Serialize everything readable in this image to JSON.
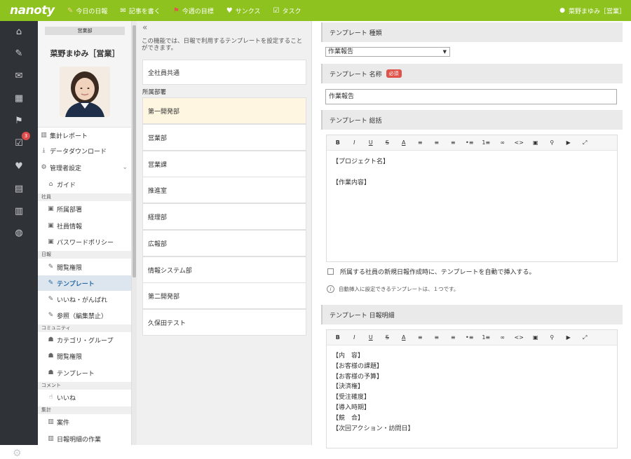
{
  "app": {
    "logo": "nanoty"
  },
  "topnav": [
    {
      "icon": "edit-icon",
      "glyph": "✎",
      "label": "今日の日報"
    },
    {
      "icon": "chat-icon",
      "glyph": "✉",
      "label": "記事を書く"
    },
    {
      "icon": "flag-icon",
      "glyph": "⚑",
      "label": "今週の目標"
    },
    {
      "icon": "heart-icon",
      "glyph": "♥",
      "label": "サンクス"
    },
    {
      "icon": "task-icon",
      "glyph": "☑",
      "label": "タスク"
    }
  ],
  "user": {
    "name": "菜野まゆみ［営業］"
  },
  "profile": {
    "dept": "営業部",
    "name": "菜野まゆみ［営業］"
  },
  "iconbar": {
    "badge": "3"
  },
  "menu": {
    "report": "集計レポート",
    "download": "データダウンロード",
    "admin": "管理者設定",
    "guide": "ガイド",
    "sec_staff": "社員",
    "dept": "所属部署",
    "staffinfo": "社員情報",
    "password": "パスワードポリシー",
    "sec_daily": "日報",
    "view": "閲覧権限",
    "template": "テンプレート",
    "like": "いいね・がんばれ",
    "ref": "参照（編集禁止）",
    "sec_community": "コミュニティ",
    "category": "カテゴリ・グループ",
    "cview": "閲覧権限",
    "ctemplate": "テンプレート",
    "sec_comment": "コメント",
    "iine": "いいね",
    "sec_agg": "集計",
    "case": "案件",
    "detailwork": "日報明細の作業"
  },
  "mid": {
    "collapse": "«",
    "description": "この機能では、日報で利用するテンプレートを設定することができます。",
    "common": "全社員共通",
    "group_label": "所属部署",
    "depts": [
      "第一開発部",
      "営業部",
      "営業課",
      "推進室",
      "経理部",
      "広報部",
      "情報システム部",
      "第二開発部",
      "久保田テスト"
    ]
  },
  "form": {
    "type_label": "テンプレート 種類",
    "type_value": "作業報告",
    "name_label": "テンプレート 名称",
    "required": "必須",
    "name_value": "作業報告",
    "summary_label": "テンプレート 総括",
    "toolbar": [
      "B",
      "I",
      "U",
      "S",
      "A",
      "≡",
      "≡",
      "≡",
      "•≡",
      "1≡",
      "∞",
      "<>",
      "▣",
      "⚲",
      "▶",
      "⤢"
    ],
    "summary_lines": [
      "【プロジェクト名】",
      "",
      "【作業内容】"
    ],
    "auto_insert": "所属する社員の新規日報作成時に、テンプレートを自動で挿入する。",
    "note": "自動挿入に設定できるテンプレートは、１つです。",
    "detail_label": "テンプレート 日報明細",
    "detail_lines": [
      "【内　容】",
      "【お客様の課題】",
      "【お客様の予算】",
      "【決済権】",
      "【受注確度】",
      "【導入時期】",
      "【競　合】",
      "【次回アクション・訪問日】"
    ]
  },
  "colors": {
    "topbar": "#8ec21f",
    "iconbar": "#2f3236",
    "active": "#dde6ee",
    "selected": "#fef6e0",
    "required": "#e0534a"
  }
}
